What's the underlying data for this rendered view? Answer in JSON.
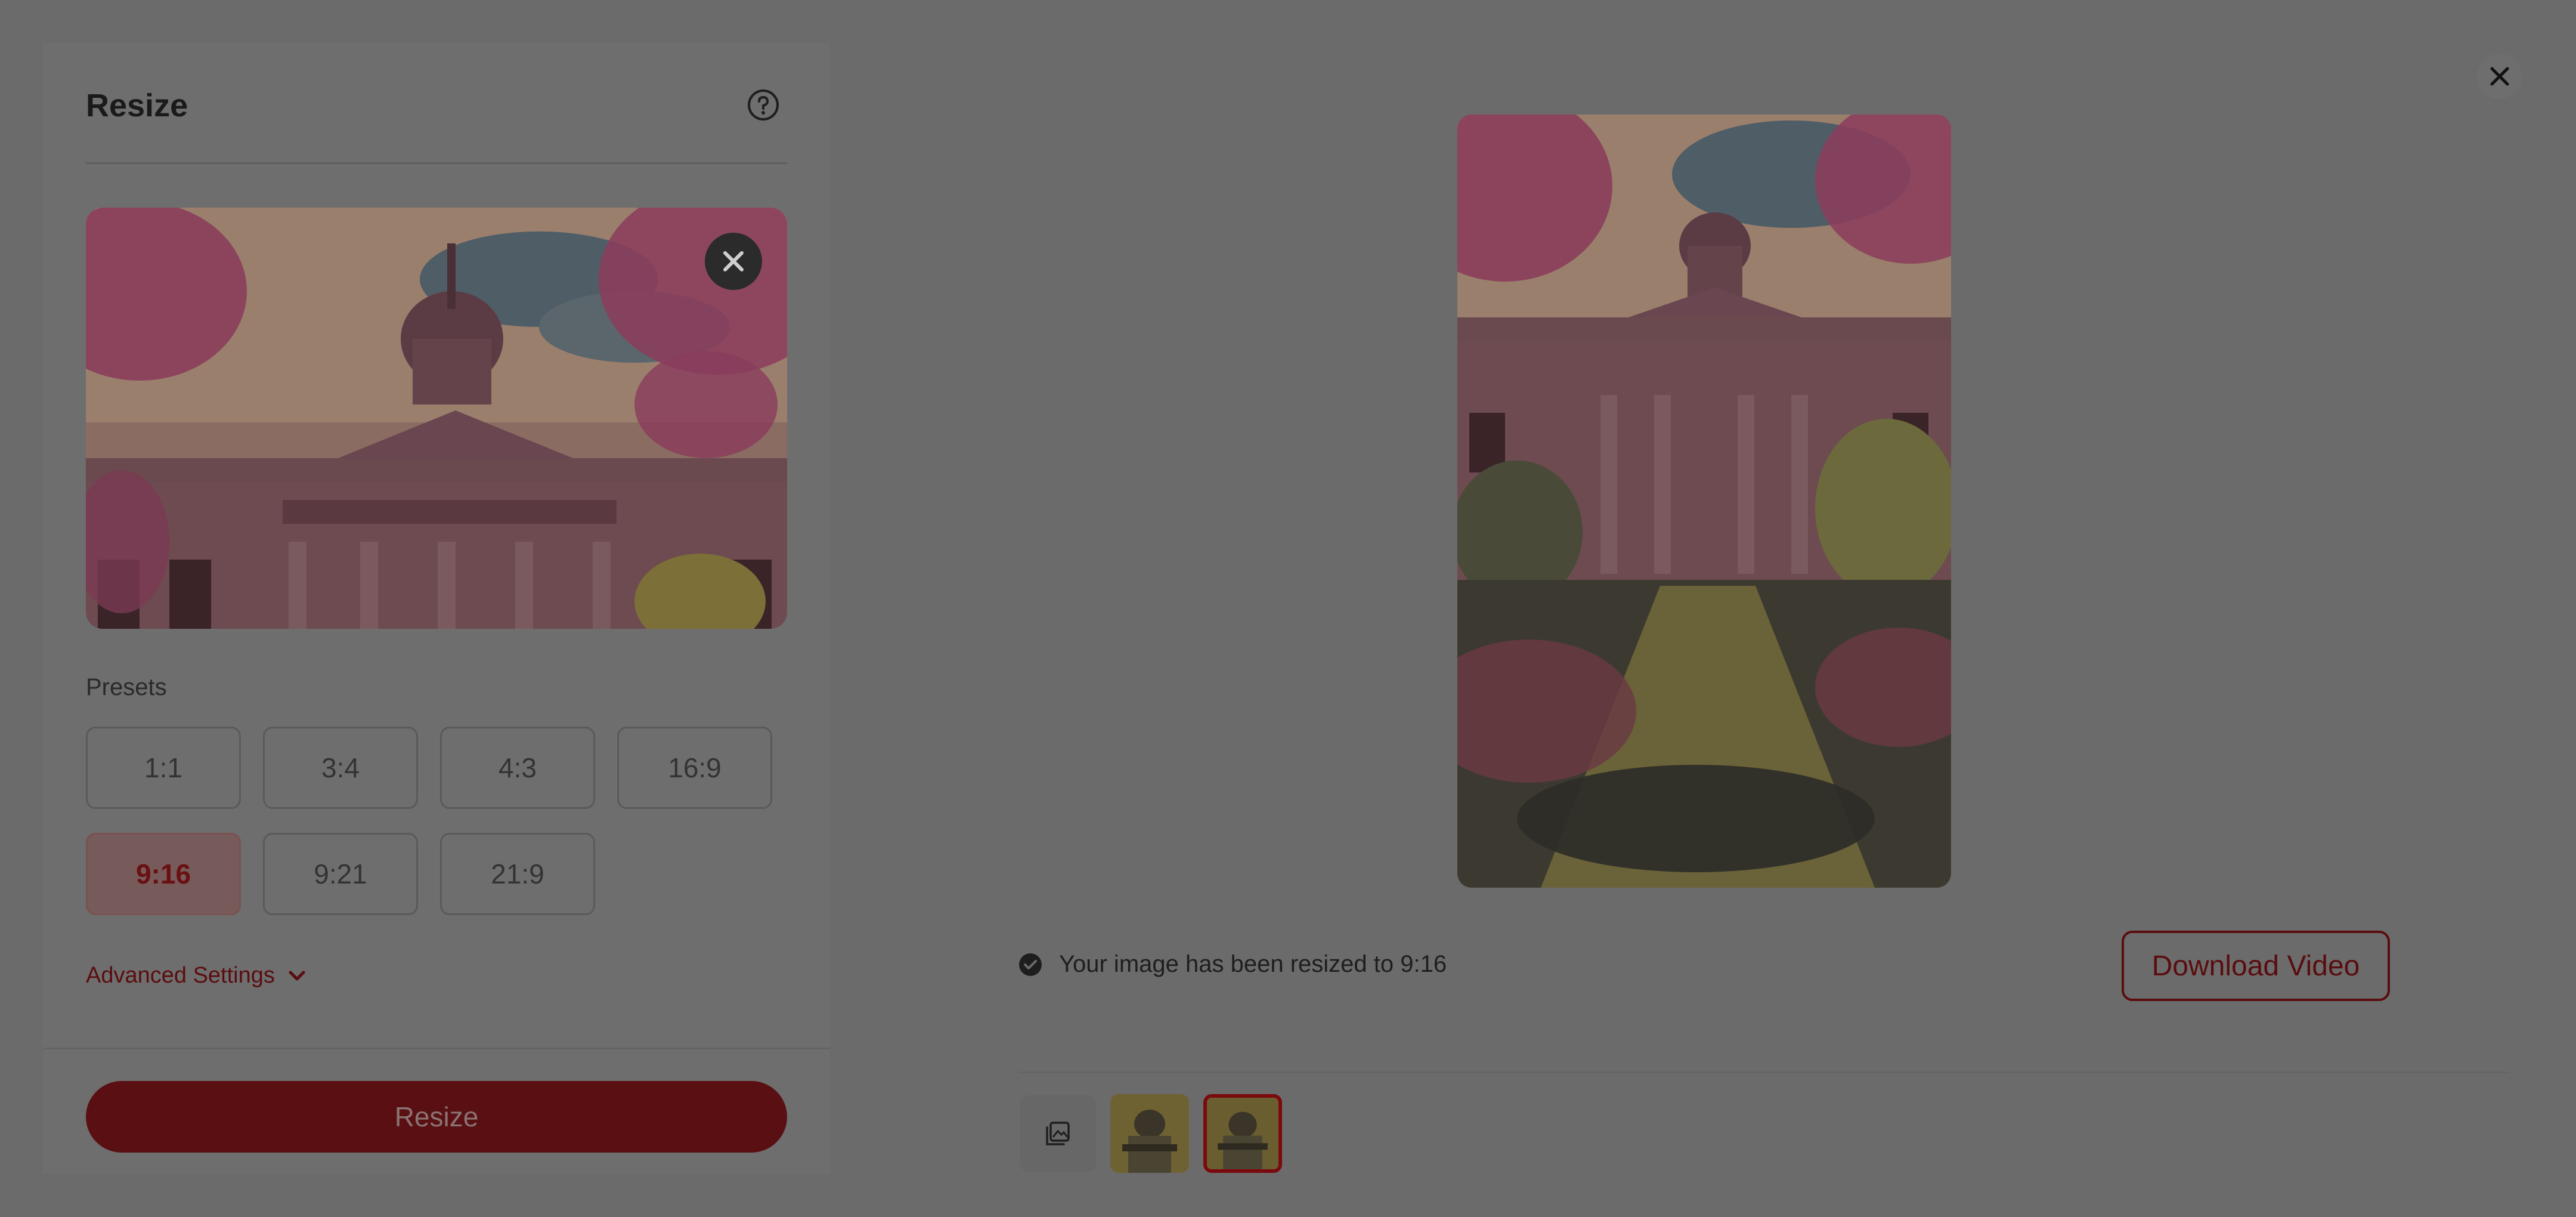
{
  "panel": {
    "title": "Resize",
    "presets_label": "Presets",
    "presets": [
      "1:1",
      "3:4",
      "4:3",
      "16:9",
      "9:16",
      "9:21",
      "21:9"
    ],
    "active_preset": "9:16",
    "advanced_settings_label": "Advanced Settings",
    "resize_button": "Resize"
  },
  "result": {
    "status_text": "Your image has been resized to 9:16",
    "download_button": "Download Video"
  },
  "icons": {
    "help": "help-circle-icon",
    "remove": "close-icon",
    "close": "close-icon",
    "check": "check-circle-icon",
    "chevron": "chevron-down-icon",
    "gallery": "gallery-icon"
  },
  "colors": {
    "accent": "#5a0d0f",
    "overlay_bg": "#6b6b6b"
  }
}
